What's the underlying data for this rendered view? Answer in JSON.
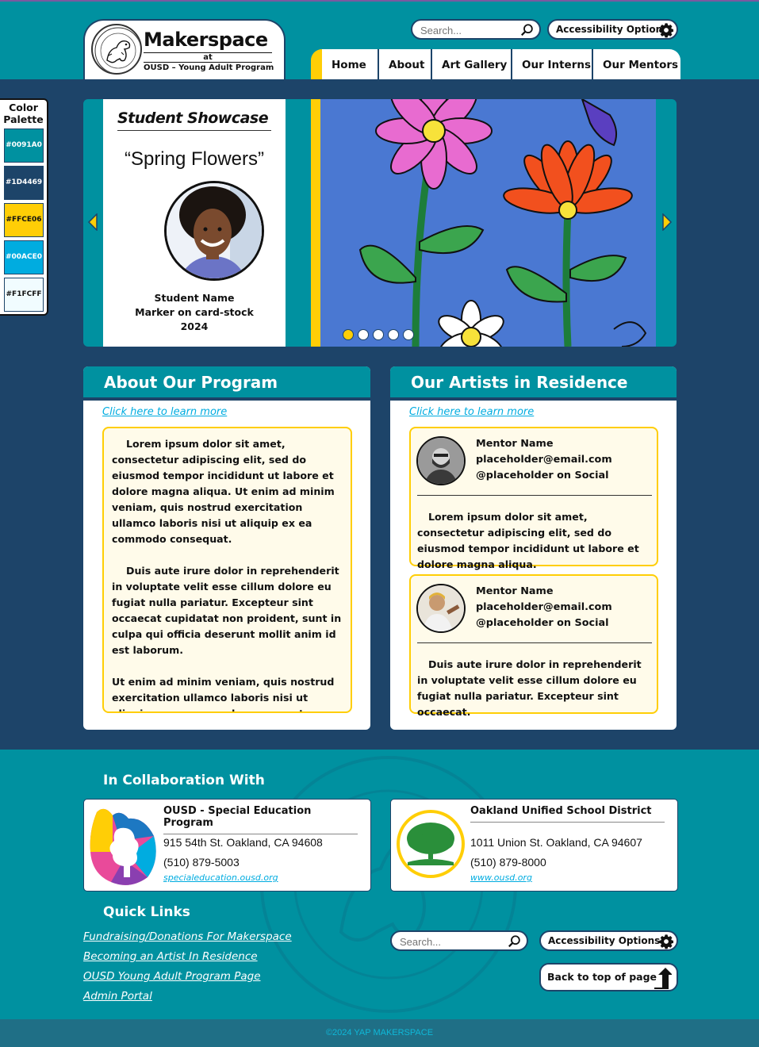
{
  "header": {
    "logo_title": "Makerspace",
    "logo_at": "at",
    "logo_subtitle": "OUSD – Young Adult Program",
    "search_placeholder": "Search...",
    "accessibility_label": "Accessibility Options",
    "nav": [
      "Home",
      "About",
      "Art Gallery",
      "Our Interns",
      "Our Mentors"
    ]
  },
  "palette": {
    "title": "Color Palette",
    "colors": [
      "#0091A0",
      "#1D4469",
      "#FFCE06",
      "#00ACE0",
      "#F1FCFF"
    ]
  },
  "showcase": {
    "heading": "Student Showcase",
    "artwork_title": "“Spring Flowers”",
    "student_name": "Student Name",
    "medium": "Marker on card-stock",
    "year": "2024",
    "slide_count": 5,
    "active_slide": 1
  },
  "about": {
    "heading": "About Our Program",
    "link": "Click here to learn more",
    "paragraphs": [
      "Lorem ipsum dolor sit amet, consectetur adipiscing elit, sed do eiusmod tempor incididunt ut labore et dolore magna aliqua. Ut enim ad minim veniam, quis nostrud exercitation ullamco laboris nisi ut aliquip ex ea commodo consequat.",
      "Duis aute irure dolor in reprehenderit in voluptate velit esse cillum dolore eu fugiat nulla pariatur. Excepteur sint occaecat cupidatat non proident, sunt in culpa qui officia deserunt mollit anim id est laborum.",
      "Ut enim ad minim veniam, quis nostrud exercitation ullamco laboris nisi ut aliquip ex ea commodo consequat. Excepteur sint occaecat cupidatat non proident."
    ]
  },
  "artists": {
    "heading": "Our Artists in Residence",
    "link": "Click here to learn more",
    "mentors": [
      {
        "name": "Mentor Name",
        "email": "placeholder@email.com",
        "social": "@placeholder on Social",
        "bio": "Lorem ipsum dolor sit amet, consectetur adipiscing elit, sed do eiusmod tempor incididunt ut labore et dolore magna aliqua."
      },
      {
        "name": "Mentor Name",
        "email": "placeholder@email.com",
        "social": "@placeholder on Social",
        "bio": "Duis aute irure dolor in reprehenderit in voluptate velit esse cillum dolore eu fugiat nulla pariatur. Excepteur sint occaecat."
      }
    ]
  },
  "footer": {
    "collab_heading": "In Collaboration With",
    "partners": [
      {
        "name": "OUSD - Special Education Program",
        "address": "915 54th St. Oakland, CA 94608",
        "phone": "(510) 879-5003",
        "link": "specialeducation.ousd.org"
      },
      {
        "name": "Oakland Unified School District",
        "address": "1011 Union St. Oakland, CA 94607",
        "phone": "(510) 879-8000",
        "link": "www.ousd.org"
      }
    ],
    "quick_links_heading": "Quick Links",
    "quick_links": [
      "Fundraising/Donations For Makerspace",
      "Becoming an Artist In Residence",
      "OUSD Young Adult Program Page",
      "Admin Portal"
    ],
    "search_placeholder": "Search...",
    "accessibility_label": "Accessibility Options",
    "back_to_top": "Back to top of page",
    "copyright": "©2024 YAP MAKERSPACE"
  }
}
